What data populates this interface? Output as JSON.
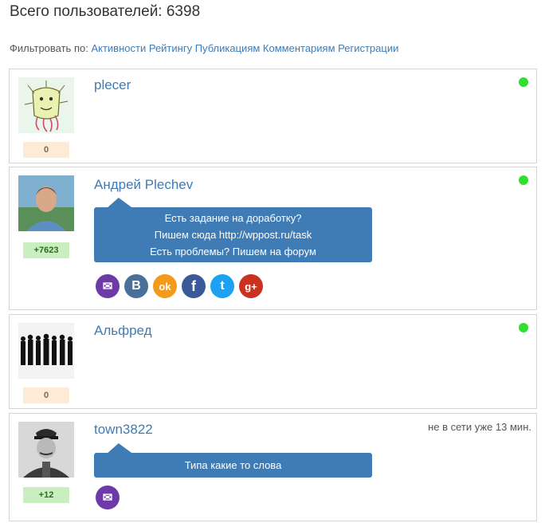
{
  "page": {
    "title": "Всего пользователей: 6398"
  },
  "filter": {
    "label": "Фильтровать по:",
    "options": [
      "Активности",
      "Рейтингу",
      "Публикациям",
      "Комментариям",
      "Регистрации"
    ]
  },
  "users": [
    {
      "name": "plecer",
      "rating": "0",
      "online": true,
      "avatar": "monster-drawing-avatar"
    },
    {
      "name": "Андрей Plechev",
      "rating": "+7623",
      "online": true,
      "avatar": "man-portrait-avatar",
      "status_lines": [
        "Есть задание на доработку?",
        "Пишем сюда http://wppost.ru/task",
        "Есть проблемы? Пишем на форум"
      ],
      "social": [
        {
          "icon": "mail-icon",
          "glyph": "✉",
          "color": "#6d3aa7"
        },
        {
          "icon": "vk-icon",
          "glyph": "B",
          "color": "#4a6f99"
        },
        {
          "icon": "odnoklassniki-icon",
          "glyph": "ok",
          "color": "#f39a1d"
        },
        {
          "icon": "facebook-icon",
          "glyph": "f",
          "color": "#3b5998"
        },
        {
          "icon": "twitter-icon",
          "glyph": "t",
          "color": "#1da1f2"
        },
        {
          "icon": "google-plus-icon",
          "glyph": "g+",
          "color": "#c8321e"
        }
      ]
    },
    {
      "name": "Альфред",
      "rating": "0",
      "online": true,
      "avatar": "silhouettes-avatar"
    },
    {
      "name": "town3822",
      "rating": "+12",
      "online": false,
      "last_seen": "не в сети уже 13 мин.",
      "avatar": "stalin-portrait-avatar",
      "status_lines": [
        "Типа какие то слова"
      ],
      "social": [
        {
          "icon": "mail-icon",
          "glyph": "✉",
          "color": "#6d3aa7"
        }
      ]
    }
  ]
}
